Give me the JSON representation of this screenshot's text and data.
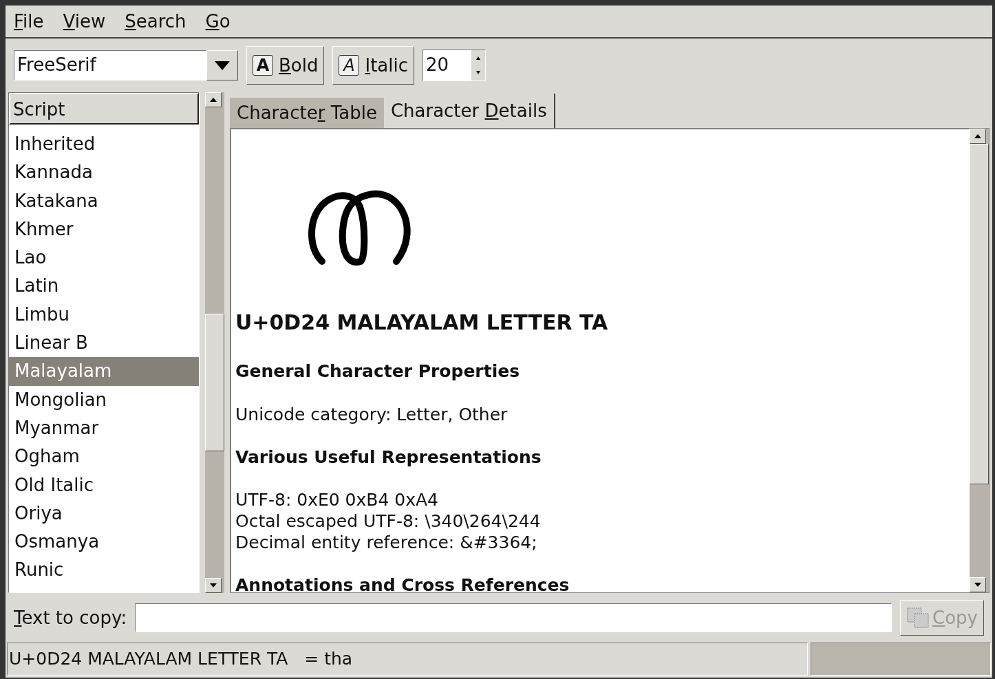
{
  "menu": [
    {
      "label": {
        "key": "F",
        "rest": "ile"
      }
    },
    {
      "label": {
        "key": "V",
        "rest": "iew"
      }
    },
    {
      "label": {
        "key": "S",
        "rest": "earch"
      }
    },
    {
      "label": {
        "key": "G",
        "rest": "o"
      }
    }
  ],
  "toolbar": {
    "font": "FreeSerif",
    "bold": {
      "icon": "A",
      "label": {
        "key": "B",
        "rest": "old"
      },
      "on": false
    },
    "italic": {
      "icon": "A",
      "label": {
        "key": "I",
        "rest": "talic"
      },
      "on": false
    },
    "size": "20"
  },
  "script_list": {
    "header": "Script",
    "items": [
      {
        "label": "Inherited",
        "selected": false
      },
      {
        "label": "Kannada",
        "selected": false
      },
      {
        "label": "Katakana",
        "selected": false
      },
      {
        "label": "Khmer",
        "selected": false
      },
      {
        "label": "Lao",
        "selected": false
      },
      {
        "label": "Latin",
        "selected": false
      },
      {
        "label": "Limbu",
        "selected": false
      },
      {
        "label": "Linear B",
        "selected": false
      },
      {
        "label": "Malayalam",
        "selected": true
      },
      {
        "label": "Mongolian",
        "selected": false
      },
      {
        "label": "Myanmar",
        "selected": false
      },
      {
        "label": "Ogham",
        "selected": false
      },
      {
        "label": "Old Italic",
        "selected": false
      },
      {
        "label": "Oriya",
        "selected": false
      },
      {
        "label": "Osmanya",
        "selected": false
      },
      {
        "label": "Runic",
        "selected": false
      }
    ]
  },
  "tabs": [
    {
      "label": {
        "pre": "Characte",
        "key": "r",
        "rest": " Table"
      },
      "selected": false
    },
    {
      "label": {
        "pre": "Character ",
        "key": "D",
        "rest": "etails"
      },
      "selected": true
    }
  ],
  "details": [
    {
      "kind": "title",
      "text": "U+0D24 MALAYALAM LETTER TA"
    },
    {
      "kind": "heading",
      "text": "General Character Properties"
    },
    {
      "kind": "line",
      "text": "Unicode category: Letter, Other"
    },
    {
      "kind": "heading",
      "text": "Various Useful Representations"
    },
    {
      "kind": "line",
      "text": "UTF-8: 0xE0 0xB4 0xA4"
    },
    {
      "kind": "tight",
      "text": "Octal escaped UTF-8: \\340\\264\\244"
    },
    {
      "kind": "tight",
      "text": "Decimal entity reference: &#3364;"
    },
    {
      "kind": "heading",
      "text": "Annotations and Cross References"
    }
  ],
  "copy_row": {
    "label": {
      "key": "T",
      "rest": "ext to copy:"
    },
    "button": {
      "key": "C",
      "rest": "opy"
    },
    "disabled": true
  },
  "status_bar": "U+0D24 MALAYALAM LETTER TA   = tha"
}
